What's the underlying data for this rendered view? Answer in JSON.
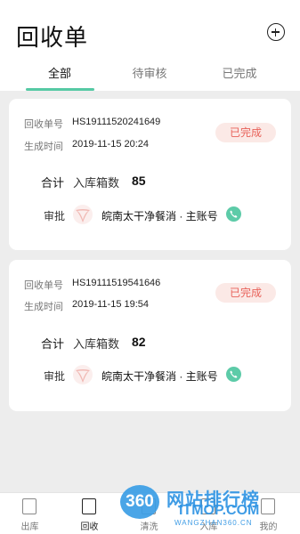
{
  "header": {
    "title": "回收单",
    "add_icon": "plus-circle-icon"
  },
  "tabs": [
    {
      "label": "全部",
      "active": true
    },
    {
      "label": "待审核",
      "active": false
    },
    {
      "label": "已完成",
      "active": false
    }
  ],
  "accent_color": "#55c9a4",
  "orders": [
    {
      "order_no_label": "回收单号",
      "order_no": "HS19111520241649",
      "time_label": "生成时间",
      "time": "2019-11-15 20:24",
      "status": "已完成",
      "total_label": "合计",
      "box_label": "入库箱数",
      "box_count": "85",
      "approve_label": "审批",
      "approver": "皖南太干净餐消 · 主账号",
      "phone_icon": "phone-icon"
    },
    {
      "order_no_label": "回收单号",
      "order_no": "HS19111519541646",
      "time_label": "生成时间",
      "time": "2019-11-15 19:54",
      "status": "已完成",
      "total_label": "合计",
      "box_label": "入库箱数",
      "box_count": "82",
      "approve_label": "审批",
      "approver": "皖南太干净餐消 · 主账号",
      "phone_icon": "phone-icon"
    }
  ],
  "bottom_nav": [
    {
      "label": "出库",
      "icon": "outbound-icon",
      "active": false
    },
    {
      "label": "回收",
      "icon": "recycle-icon",
      "active": true
    },
    {
      "label": "清洗",
      "icon": "wash-icon",
      "active": false
    },
    {
      "label": "入库",
      "icon": "inbound-icon",
      "active": false
    },
    {
      "label": "我的",
      "icon": "profile-icon",
      "active": false
    }
  ],
  "watermark": {
    "logo": "360",
    "name": "网站排行榜",
    "domain": "ITMOP.COM",
    "sub": "WANGZHAN360.CN"
  }
}
